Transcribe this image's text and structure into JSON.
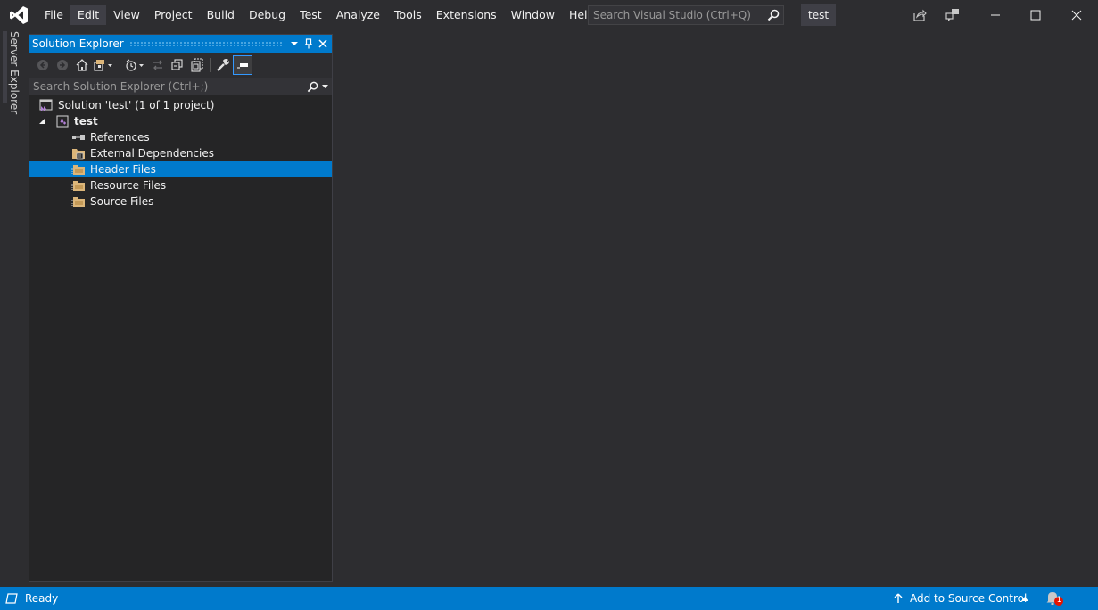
{
  "menubar": {
    "items": [
      "File",
      "Edit",
      "View",
      "Project",
      "Build",
      "Debug",
      "Test",
      "Analyze",
      "Tools",
      "Extensions",
      "Window",
      "Help"
    ],
    "active_index": 1
  },
  "search": {
    "placeholder": "Search Visual Studio (Ctrl+Q)"
  },
  "solution_badge": "test",
  "side_tabs": {
    "server_explorer": "Server Explorer"
  },
  "solution_explorer": {
    "title": "Solution Explorer",
    "search_placeholder": "Search Solution Explorer (Ctrl+;)",
    "tree": {
      "solution": "Solution 'test' (1 of 1 project)",
      "project": "test",
      "items": [
        "References",
        "External Dependencies",
        "Header Files",
        "Resource Files",
        "Source Files"
      ],
      "selected": "Header Files"
    }
  },
  "statusbar": {
    "status": "Ready",
    "source_control": "Add to Source Control",
    "notification_count": "1"
  },
  "colors": {
    "accent": "#007acc",
    "background": "#2d2d30",
    "panel": "#252526"
  }
}
